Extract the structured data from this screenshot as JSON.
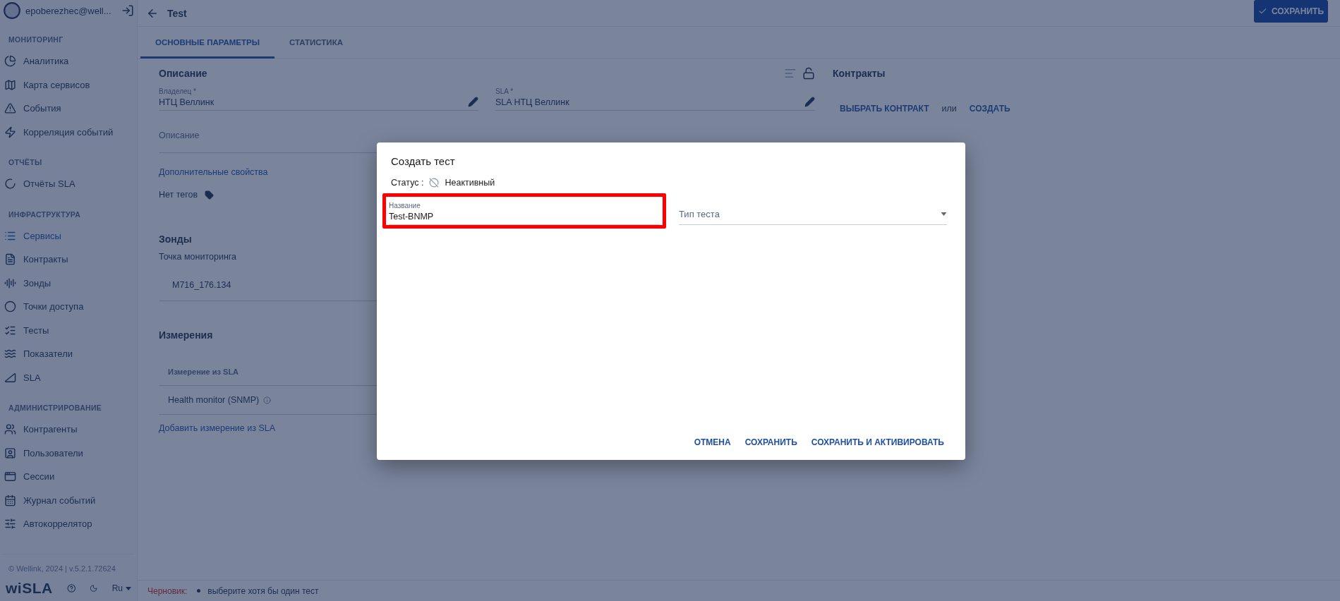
{
  "user": {
    "email": "epoberezhec@well..."
  },
  "sidebar": {
    "sections": [
      {
        "title": "МОНИТОРИНГ",
        "items": [
          {
            "label": "Аналитика",
            "selected": false
          },
          {
            "label": "Карта сервисов",
            "selected": false
          },
          {
            "label": "События",
            "selected": false
          },
          {
            "label": "Корреляция событий",
            "selected": false
          }
        ]
      },
      {
        "title": "ОТЧЁТЫ",
        "items": [
          {
            "label": "Отчёты SLA",
            "selected": false
          }
        ]
      },
      {
        "title": "ИНФРАСТРУКТУРА",
        "items": [
          {
            "label": "Сервисы",
            "selected": true
          },
          {
            "label": "Контракты",
            "selected": false
          },
          {
            "label": "Зонды",
            "selected": false
          },
          {
            "label": "Точки доступа",
            "selected": false
          },
          {
            "label": "Тесты",
            "selected": false
          },
          {
            "label": "Показатели",
            "selected": false
          },
          {
            "label": "SLA",
            "selected": false
          }
        ]
      },
      {
        "title": "АДМИНИСТРИРОВАНИЕ",
        "items": [
          {
            "label": "Контрагенты",
            "selected": false
          },
          {
            "label": "Пользователи",
            "selected": false
          },
          {
            "label": "Сессии",
            "selected": false
          },
          {
            "label": "Журнал событий",
            "selected": false
          },
          {
            "label": "Автокоррелятор",
            "selected": false
          }
        ]
      }
    ],
    "copyright": "© Wellink, 2024 | v.5.2.1.72624",
    "logo": "wiSLA",
    "language": "Ru"
  },
  "header": {
    "title": "Test",
    "save_button": "СОХРАНИТЬ"
  },
  "tabs": [
    {
      "label": "ОСНОВНЫЕ ПАРАМЕТРЫ",
      "selected": true
    },
    {
      "label": "СТАТИСТИКА",
      "selected": false
    }
  ],
  "description_section": {
    "title": "Описание",
    "fields": [
      {
        "label": "Владелец *",
        "value": "НТЦ Веллинк"
      },
      {
        "label": "SLA *",
        "value": "SLA НТЦ Веллинк"
      }
    ],
    "description_placeholder": "Описание",
    "extra_link": "Дополнительные свойства",
    "tags": "Нет тегов"
  },
  "probes": {
    "title": "Зонды",
    "label": "Точка мониторинга",
    "rows": [
      "M716_176.134"
    ]
  },
  "measurements": {
    "title": "Измерения",
    "column": "Измерение из SLA",
    "rows": [
      "Health monitor (SNMP)"
    ],
    "add_link": "Добавить измерение из SLA"
  },
  "contracts": {
    "title": "Контракты",
    "choose": "ВЫБРАТЬ КОНТРАКТ",
    "or": "или",
    "create": "СОЗДАТЬ"
  },
  "status_bar": {
    "label": "Черновик:",
    "messages": [
      "выберите хотя бы один тест"
    ]
  },
  "dialog": {
    "title": "Создать тест",
    "status_label": "Статус :",
    "status": "Неактивный",
    "name_field": {
      "label": "Название",
      "value": "Test-BNMP",
      "highlighted": true
    },
    "type_field": {
      "placeholder": "Тип теста"
    },
    "buttons": [
      "ОТМЕНА",
      "СОХРАНИТЬ",
      "СОХРАНИТЬ И АКТИВИРОВАТЬ"
    ]
  }
}
